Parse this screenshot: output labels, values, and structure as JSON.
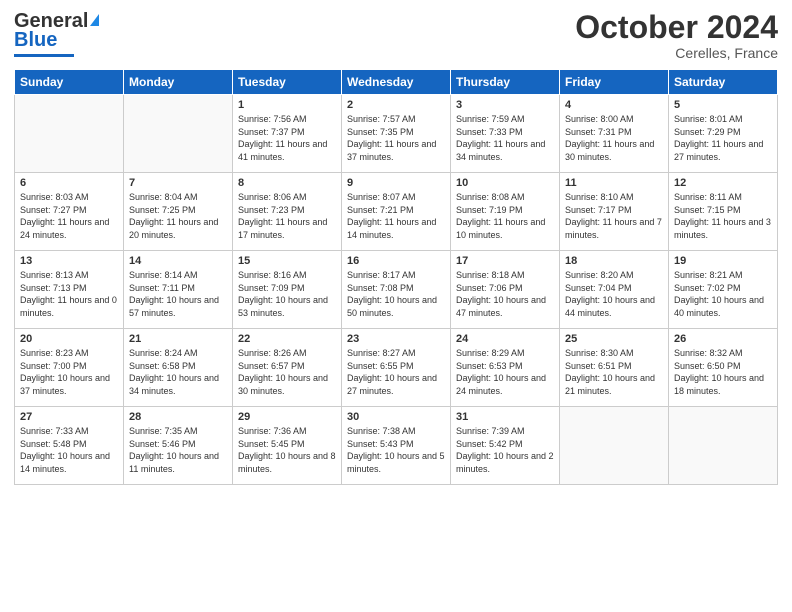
{
  "header": {
    "logo_general": "General",
    "logo_blue": "Blue",
    "month_title": "October 2024",
    "subtitle": "Cerelles, France"
  },
  "weekdays": [
    "Sunday",
    "Monday",
    "Tuesday",
    "Wednesday",
    "Thursday",
    "Friday",
    "Saturday"
  ],
  "weeks": [
    [
      {
        "day": "",
        "sunrise": "",
        "sunset": "",
        "daylight": ""
      },
      {
        "day": "",
        "sunrise": "",
        "sunset": "",
        "daylight": ""
      },
      {
        "day": "1",
        "sunrise": "Sunrise: 7:56 AM",
        "sunset": "Sunset: 7:37 PM",
        "daylight": "Daylight: 11 hours and 41 minutes."
      },
      {
        "day": "2",
        "sunrise": "Sunrise: 7:57 AM",
        "sunset": "Sunset: 7:35 PM",
        "daylight": "Daylight: 11 hours and 37 minutes."
      },
      {
        "day": "3",
        "sunrise": "Sunrise: 7:59 AM",
        "sunset": "Sunset: 7:33 PM",
        "daylight": "Daylight: 11 hours and 34 minutes."
      },
      {
        "day": "4",
        "sunrise": "Sunrise: 8:00 AM",
        "sunset": "Sunset: 7:31 PM",
        "daylight": "Daylight: 11 hours and 30 minutes."
      },
      {
        "day": "5",
        "sunrise": "Sunrise: 8:01 AM",
        "sunset": "Sunset: 7:29 PM",
        "daylight": "Daylight: 11 hours and 27 minutes."
      }
    ],
    [
      {
        "day": "6",
        "sunrise": "Sunrise: 8:03 AM",
        "sunset": "Sunset: 7:27 PM",
        "daylight": "Daylight: 11 hours and 24 minutes."
      },
      {
        "day": "7",
        "sunrise": "Sunrise: 8:04 AM",
        "sunset": "Sunset: 7:25 PM",
        "daylight": "Daylight: 11 hours and 20 minutes."
      },
      {
        "day": "8",
        "sunrise": "Sunrise: 8:06 AM",
        "sunset": "Sunset: 7:23 PM",
        "daylight": "Daylight: 11 hours and 17 minutes."
      },
      {
        "day": "9",
        "sunrise": "Sunrise: 8:07 AM",
        "sunset": "Sunset: 7:21 PM",
        "daylight": "Daylight: 11 hours and 14 minutes."
      },
      {
        "day": "10",
        "sunrise": "Sunrise: 8:08 AM",
        "sunset": "Sunset: 7:19 PM",
        "daylight": "Daylight: 11 hours and 10 minutes."
      },
      {
        "day": "11",
        "sunrise": "Sunrise: 8:10 AM",
        "sunset": "Sunset: 7:17 PM",
        "daylight": "Daylight: 11 hours and 7 minutes."
      },
      {
        "day": "12",
        "sunrise": "Sunrise: 8:11 AM",
        "sunset": "Sunset: 7:15 PM",
        "daylight": "Daylight: 11 hours and 3 minutes."
      }
    ],
    [
      {
        "day": "13",
        "sunrise": "Sunrise: 8:13 AM",
        "sunset": "Sunset: 7:13 PM",
        "daylight": "Daylight: 11 hours and 0 minutes."
      },
      {
        "day": "14",
        "sunrise": "Sunrise: 8:14 AM",
        "sunset": "Sunset: 7:11 PM",
        "daylight": "Daylight: 10 hours and 57 minutes."
      },
      {
        "day": "15",
        "sunrise": "Sunrise: 8:16 AM",
        "sunset": "Sunset: 7:09 PM",
        "daylight": "Daylight: 10 hours and 53 minutes."
      },
      {
        "day": "16",
        "sunrise": "Sunrise: 8:17 AM",
        "sunset": "Sunset: 7:08 PM",
        "daylight": "Daylight: 10 hours and 50 minutes."
      },
      {
        "day": "17",
        "sunrise": "Sunrise: 8:18 AM",
        "sunset": "Sunset: 7:06 PM",
        "daylight": "Daylight: 10 hours and 47 minutes."
      },
      {
        "day": "18",
        "sunrise": "Sunrise: 8:20 AM",
        "sunset": "Sunset: 7:04 PM",
        "daylight": "Daylight: 10 hours and 44 minutes."
      },
      {
        "day": "19",
        "sunrise": "Sunrise: 8:21 AM",
        "sunset": "Sunset: 7:02 PM",
        "daylight": "Daylight: 10 hours and 40 minutes."
      }
    ],
    [
      {
        "day": "20",
        "sunrise": "Sunrise: 8:23 AM",
        "sunset": "Sunset: 7:00 PM",
        "daylight": "Daylight: 10 hours and 37 minutes."
      },
      {
        "day": "21",
        "sunrise": "Sunrise: 8:24 AM",
        "sunset": "Sunset: 6:58 PM",
        "daylight": "Daylight: 10 hours and 34 minutes."
      },
      {
        "day": "22",
        "sunrise": "Sunrise: 8:26 AM",
        "sunset": "Sunset: 6:57 PM",
        "daylight": "Daylight: 10 hours and 30 minutes."
      },
      {
        "day": "23",
        "sunrise": "Sunrise: 8:27 AM",
        "sunset": "Sunset: 6:55 PM",
        "daylight": "Daylight: 10 hours and 27 minutes."
      },
      {
        "day": "24",
        "sunrise": "Sunrise: 8:29 AM",
        "sunset": "Sunset: 6:53 PM",
        "daylight": "Daylight: 10 hours and 24 minutes."
      },
      {
        "day": "25",
        "sunrise": "Sunrise: 8:30 AM",
        "sunset": "Sunset: 6:51 PM",
        "daylight": "Daylight: 10 hours and 21 minutes."
      },
      {
        "day": "26",
        "sunrise": "Sunrise: 8:32 AM",
        "sunset": "Sunset: 6:50 PM",
        "daylight": "Daylight: 10 hours and 18 minutes."
      }
    ],
    [
      {
        "day": "27",
        "sunrise": "Sunrise: 7:33 AM",
        "sunset": "Sunset: 5:48 PM",
        "daylight": "Daylight: 10 hours and 14 minutes."
      },
      {
        "day": "28",
        "sunrise": "Sunrise: 7:35 AM",
        "sunset": "Sunset: 5:46 PM",
        "daylight": "Daylight: 10 hours and 11 minutes."
      },
      {
        "day": "29",
        "sunrise": "Sunrise: 7:36 AM",
        "sunset": "Sunset: 5:45 PM",
        "daylight": "Daylight: 10 hours and 8 minutes."
      },
      {
        "day": "30",
        "sunrise": "Sunrise: 7:38 AM",
        "sunset": "Sunset: 5:43 PM",
        "daylight": "Daylight: 10 hours and 5 minutes."
      },
      {
        "day": "31",
        "sunrise": "Sunrise: 7:39 AM",
        "sunset": "Sunset: 5:42 PM",
        "daylight": "Daylight: 10 hours and 2 minutes."
      },
      {
        "day": "",
        "sunrise": "",
        "sunset": "",
        "daylight": ""
      },
      {
        "day": "",
        "sunrise": "",
        "sunset": "",
        "daylight": ""
      }
    ]
  ]
}
